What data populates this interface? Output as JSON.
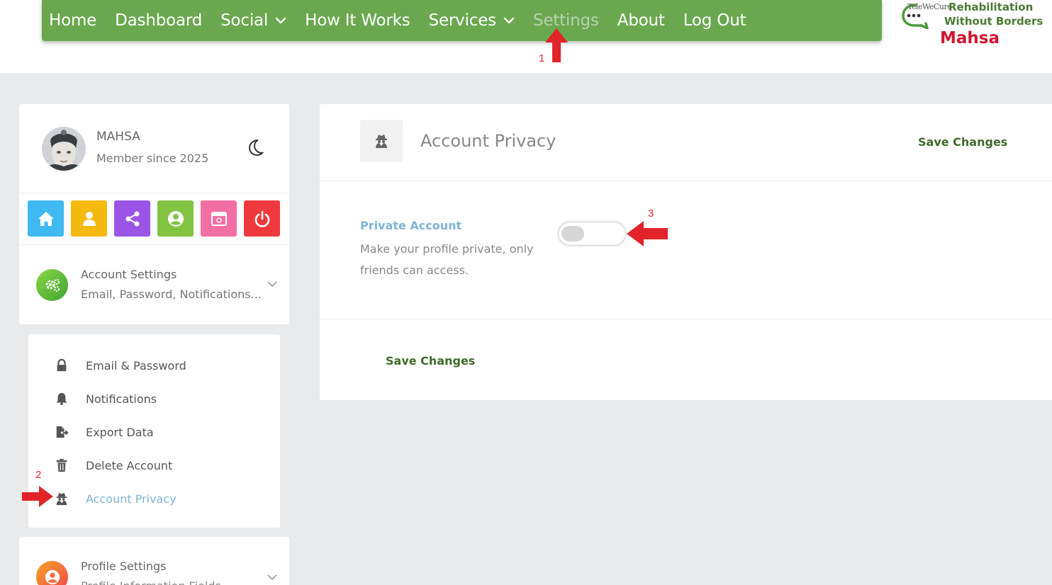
{
  "nav": {
    "items": [
      {
        "label": "Home",
        "dropdown": false,
        "active": false
      },
      {
        "label": "Dashboard",
        "dropdown": false,
        "active": false
      },
      {
        "label": "Social",
        "dropdown": true,
        "active": false
      },
      {
        "label": "How It Works",
        "dropdown": false,
        "active": false
      },
      {
        "label": "Services",
        "dropdown": true,
        "active": false
      },
      {
        "label": "Settings",
        "dropdown": false,
        "active": true
      },
      {
        "label": "About",
        "dropdown": false,
        "active": false
      },
      {
        "label": "Log Out",
        "dropdown": false,
        "active": false
      }
    ]
  },
  "logo": {
    "small": "TeleWeCure",
    "line1": "Rehabilitation",
    "line2": "Without Borders",
    "line3": "Mahsa"
  },
  "annotations": {
    "n1": "1",
    "n2": "2",
    "n3": "3",
    "color": "#e0242a"
  },
  "profile": {
    "name": "MAHSA",
    "since": "Member since 2025"
  },
  "quick_actions": [
    {
      "icon": "home-icon",
      "color": "#3fb9f0"
    },
    {
      "icon": "user-icon",
      "color": "#f5b90f"
    },
    {
      "icon": "share-icon",
      "color": "#9a55e6"
    },
    {
      "icon": "account-circle-icon",
      "color": "#82c341"
    },
    {
      "icon": "browser-window-icon",
      "color": "#f26fa3"
    },
    {
      "icon": "power-icon",
      "color": "#ee3a3e"
    }
  ],
  "account_settings": {
    "title": "Account Settings",
    "subtitle": "Email, Password, Notifications..."
  },
  "submenu": [
    {
      "label": "Email & Password",
      "icon": "lock-icon",
      "active": false
    },
    {
      "label": "Notifications",
      "icon": "bell-icon",
      "active": false
    },
    {
      "label": "Export Data",
      "icon": "file-export-icon",
      "active": false
    },
    {
      "label": "Delete Account",
      "icon": "trash-icon",
      "active": false
    },
    {
      "label": "Account Privacy",
      "icon": "user-secret-icon",
      "active": true
    }
  ],
  "profile_settings": {
    "title": "Profile Settings",
    "subtitle": "Profile Information Fields"
  },
  "main": {
    "title": "Account Privacy",
    "save_top": "Save Changes",
    "private_label": "Private Account",
    "private_desc": "Make your profile private, only friends can access.",
    "private_enabled": false,
    "save_bottom": "Save Changes"
  },
  "colors": {
    "nav_green": "#6aa84f",
    "active_blue": "#7fb3d5",
    "save_green": "#3d6b2a",
    "logo_red": "#d0152e"
  }
}
